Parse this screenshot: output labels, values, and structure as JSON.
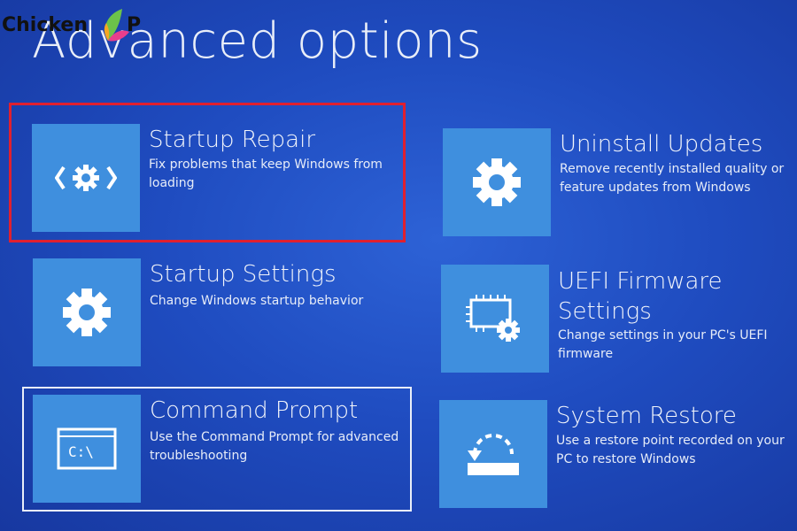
{
  "watermark": {
    "text_a": "Chicken",
    "text_b": "P"
  },
  "page": {
    "title": "Advanced options"
  },
  "options": [
    {
      "title": "Startup Repair",
      "description": "Fix problems that keep Windows from loading",
      "icon": "startup-repair-gear-icon"
    },
    {
      "title": "Uninstall Updates",
      "description": "Remove recently installed quality or feature updates from Windows",
      "icon": "gear-icon"
    },
    {
      "title": "Startup Settings",
      "description": "Change Windows startup behavior",
      "icon": "gear-icon"
    },
    {
      "title": "UEFI Firmware Settings",
      "description": "Change settings in your PC's UEFI firmware",
      "icon": "chip-gear-icon"
    },
    {
      "title": "Command Prompt",
      "description": "Use the Command Prompt for advanced troubleshooting",
      "icon": "command-prompt-icon",
      "icon_text": "C:\\"
    },
    {
      "title": "System Restore",
      "description": "Use a restore point recorded on your PC to restore Windows",
      "icon": "system-restore-icon"
    }
  ],
  "colors": {
    "background": "#1f4cc0",
    "tile": "#3f8fde",
    "highlight": "#e0202f",
    "focus": "#e9eef8"
  }
}
